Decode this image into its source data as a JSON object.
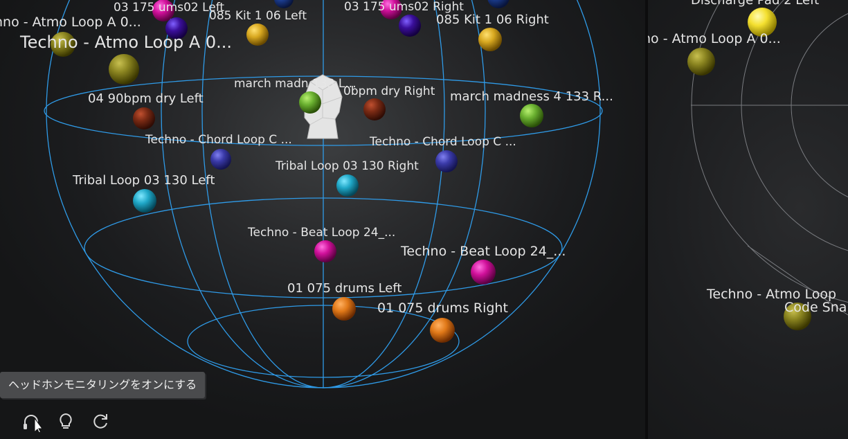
{
  "main_view": {
    "labels": {
      "atmo_a_top": "hno - Atmo Loop A 0...",
      "atmo_a_big": "Techno - Atmo Loop A 0...",
      "drums02_left": "03 175 ums02 Left",
      "drums02_right": "03 175 ums02 Right",
      "kit_left": "085 Kit 1 06 Left",
      "kit_right": "085 Kit 1 06 Right",
      "march_left": "march madn 133 L...",
      "dry_right": "0bpm dry Right",
      "march_right": "march madness 4 133 R...",
      "dry_left": "04 90bpm dry Left",
      "chord_left": "Techno - Chord Loop C ...",
      "chord_right": "Techno - Chord Loop C ...",
      "tribal_right": "Tribal Loop 03 130 Right",
      "tribal_left": "Tribal Loop 03 130 Left",
      "beat_left": "Techno - Beat Loop 24_...",
      "beat_right": "Techno - Beat Loop 24_...",
      "drums_left": "01 075 drums Left",
      "drums_right": "01 075 drums Right"
    }
  },
  "side_view": {
    "labels": {
      "discharge": "Discharge Pad 2 Left",
      "atmo": "no - Atmo Loop A 0...",
      "atmo_bottom": "Techno - Atmo Loop",
      "code": "Code Sna"
    }
  },
  "tooltip": {
    "text": "ヘッドホンモニタリングをオンにする"
  },
  "toolbar": {
    "headphones": "headphones-icon",
    "bulb": "lightbulb-icon",
    "reset": "refresh-icon"
  },
  "colors": {
    "grid": "#2f9be8",
    "magenta": "#d0109a",
    "purple": "#3a0f9a",
    "gold": "#d8a820",
    "olive": "#8a8420",
    "brown": "#7a2a14",
    "green": "#6ab030",
    "indigo": "#3a3aa8",
    "cyan": "#20a8c8",
    "orange": "#e07818",
    "yellow": "#f4e030"
  }
}
